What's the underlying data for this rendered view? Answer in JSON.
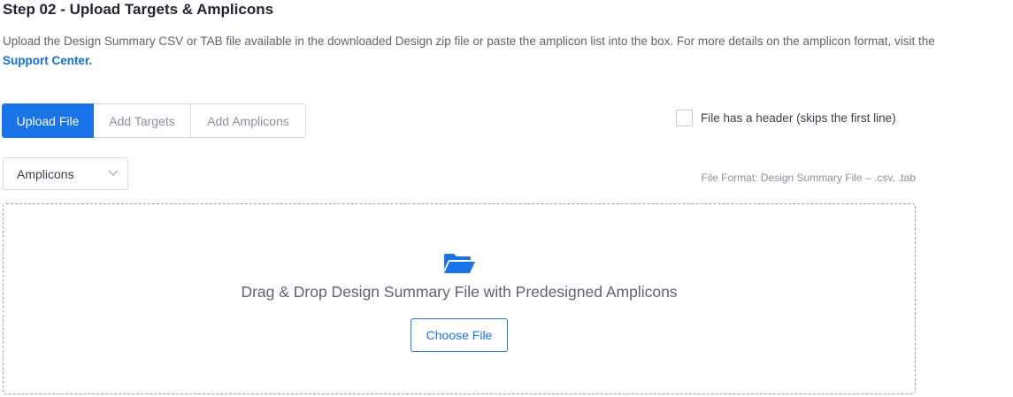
{
  "step": {
    "title": "Step 02 - Upload Targets & Amplicons",
    "description": "Upload the Design Summary CSV or TAB file available in the downloaded Design zip file or paste the amplicon list into the box. For more details on the amplicon format, visit the",
    "support_link": "Support Center."
  },
  "tabs": {
    "upload": "Upload File",
    "targets": "Add Targets",
    "amplicons": "Add Amplicons",
    "active": "Upload File"
  },
  "header_checkbox": {
    "label": "File has a header (skips the first line)",
    "checked": false
  },
  "type_select": {
    "selected": "Amplicons",
    "icon": "chevron-down-icon"
  },
  "format_note": "File Format: Design Summary File – .csv, .tab",
  "dropzone": {
    "icon": "folder-open-icon",
    "text": "Drag & Drop Design Summary File with Predesigned Amplicons",
    "button": "Choose File"
  },
  "colors": {
    "accent": "#1a73e8",
    "link": "#1470e0",
    "muted_text": "#8a909c"
  }
}
